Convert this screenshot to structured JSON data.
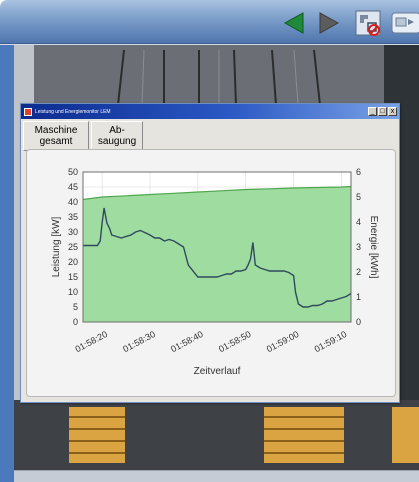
{
  "window": {
    "title": "Leistung und Energiemonitor LEM",
    "controls": {
      "minimize": "_",
      "maximize": "□",
      "close": "x"
    }
  },
  "toolbar": {
    "machine_button": {
      "line1": "Maschine",
      "line2": "gesamt"
    },
    "extraction_button": {
      "line1": "Ab-",
      "line2": "saugung"
    }
  },
  "nav": {
    "back_icon": "arrow-left-icon",
    "forward_icon": "arrow-right-icon",
    "colors": {
      "back": "#1f8a3a",
      "forward": "#5c5c5c"
    }
  },
  "chart_data": {
    "type": "line",
    "title": "",
    "xlabel": "Zeitverlauf",
    "ylabel": "Leistung [kW]",
    "y2label": "Energie [kWh]",
    "x_tick_labels": [
      "01:58:20",
      "01:58:30",
      "01:58:40",
      "01:58:50",
      "01:59:00",
      "01:59:10"
    ],
    "x_ticks": [
      20,
      30,
      40,
      50,
      60,
      70
    ],
    "xlim": [
      16,
      72
    ],
    "ylim": [
      0,
      50
    ],
    "y_ticks": [
      0,
      5,
      10,
      15,
      20,
      25,
      30,
      35,
      40,
      45,
      50
    ],
    "y2lim": [
      0,
      6
    ],
    "y2_ticks": [
      0,
      1,
      2,
      3,
      4,
      5,
      6
    ],
    "grid": true,
    "colors": {
      "fill": "#9fdc9f",
      "energy_line": "#4fa64f",
      "power_line": "#2f4a5e"
    },
    "series": [
      {
        "axis": "y2",
        "x": [
          16,
          20,
          25,
          30,
          35,
          40,
          45,
          50,
          55,
          60,
          65,
          70,
          72
        ],
        "values": [
          4.9,
          5.0,
          5.05,
          5.1,
          5.15,
          5.2,
          5.25,
          5.3,
          5.33,
          5.36,
          5.38,
          5.4,
          5.42
        ]
      },
      {
        "axis": "y",
        "x": [
          16,
          18,
          19,
          19.6,
          20,
          20.4,
          21,
          21.6,
          22,
          24,
          26,
          27,
          28,
          30,
          31,
          32,
          33,
          34,
          35,
          36,
          37,
          38,
          40,
          42,
          43,
          44,
          45,
          46,
          47,
          48,
          49,
          50,
          50.5,
          51,
          51.5,
          52,
          53,
          55,
          57,
          58,
          59,
          60,
          60.4,
          61,
          62,
          63,
          64,
          65,
          66,
          67,
          68,
          69,
          70,
          71,
          72
        ],
        "values": [
          25.5,
          25.5,
          25.5,
          27,
          33,
          38,
          33,
          31,
          29,
          28,
          29,
          30,
          30.5,
          29,
          28,
          28,
          27,
          27.5,
          27,
          26,
          25,
          19,
          15,
          15,
          15,
          15,
          15.5,
          16,
          16,
          17,
          17,
          17.5,
          19,
          21,
          26.5,
          19,
          18,
          17,
          17,
          17,
          16.5,
          15.5,
          10,
          6,
          5,
          5,
          5.5,
          5.5,
          6,
          7,
          7,
          7.5,
          8,
          8.5,
          9.5
        ]
      }
    ]
  }
}
